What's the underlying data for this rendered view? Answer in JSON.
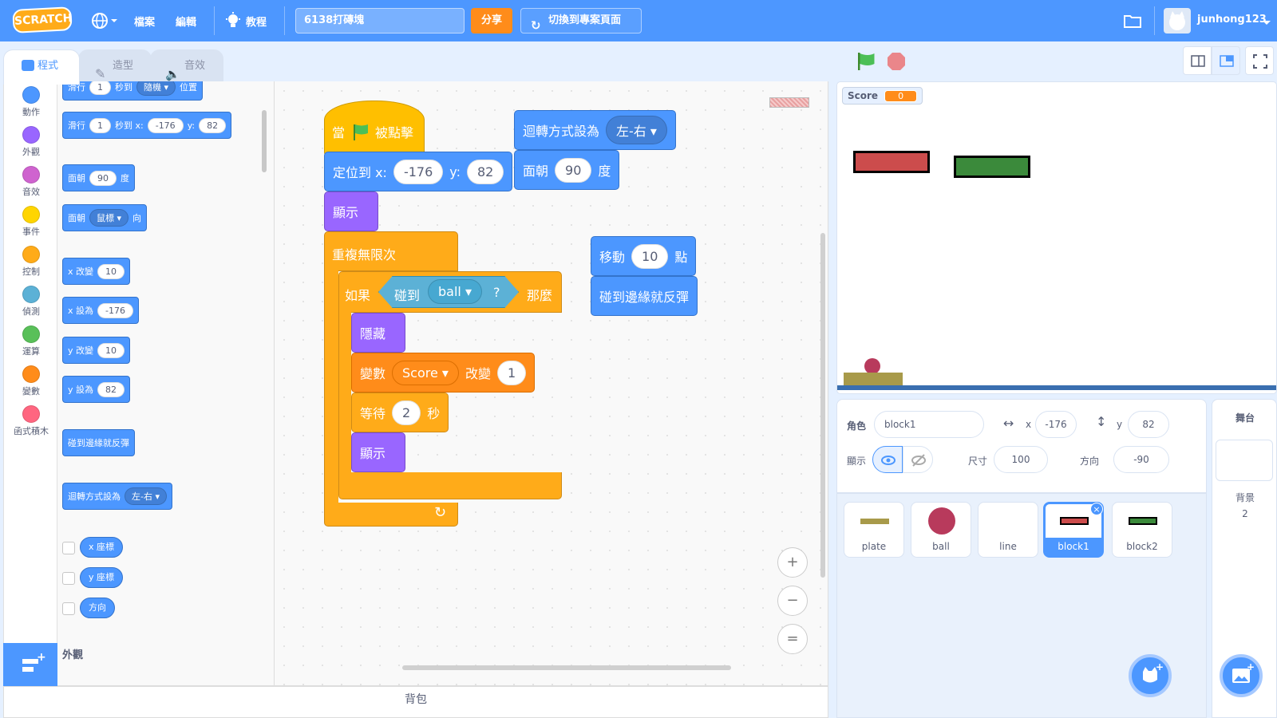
{
  "menubar": {
    "logo": "SCRATCH",
    "file": "檔案",
    "edit": "編輯",
    "tutorials": "教程",
    "project_title": "6138打磚塊",
    "share": "分享",
    "project_page": "切換到專案頁面",
    "username": "junhong123"
  },
  "tabs": {
    "code": "程式",
    "costumes": "造型",
    "sounds": "音效"
  },
  "categories": [
    {
      "label": "動作",
      "color": "#4c97ff"
    },
    {
      "label": "外觀",
      "color": "#9966ff"
    },
    {
      "label": "音效",
      "color": "#cf63cf"
    },
    {
      "label": "事件",
      "color": "#ffd500"
    },
    {
      "label": "控制",
      "color": "#ffab19"
    },
    {
      "label": "偵測",
      "color": "#5cb1d6"
    },
    {
      "label": "運算",
      "color": "#59c059"
    },
    {
      "label": "變數",
      "color": "#ff8c1a"
    },
    {
      "label": "函式積木",
      "color": "#ff6680"
    }
  ],
  "palette": {
    "glide_random": {
      "a": "滑行",
      "secs": "1",
      "b": "秒到",
      "target": "隨機",
      "c": "位置"
    },
    "glide_xy": {
      "a": "滑行",
      "secs": "1",
      "b": "秒到 x:",
      "x": "-176",
      "c": "y:",
      "y": "82"
    },
    "point_dir": {
      "a": "面朝",
      "deg": "90",
      "b": "度"
    },
    "point_towards": {
      "a": "面朝",
      "target": "鼠標",
      "b": "向"
    },
    "change_x": {
      "a": "x 改變",
      "v": "10"
    },
    "set_x": {
      "a": "x 設為",
      "v": "-176"
    },
    "change_y": {
      "a": "y 改變",
      "v": "10"
    },
    "set_y": {
      "a": "y 設為",
      "v": "82"
    },
    "bounce": "碰到邊緣就反彈",
    "rotation_style": {
      "a": "迴轉方式設為",
      "v": "左-右"
    },
    "x_pos": "x 座標",
    "y_pos": "y 座標",
    "direction": "方向",
    "looks_heading": "外觀"
  },
  "script": {
    "when_flag_a": "當",
    "when_flag_b": "被點擊",
    "goto": {
      "a": "定位到 x:",
      "x": "-176",
      "b": "y:",
      "y": "82"
    },
    "show1": "顯示",
    "forever": "重複無限次",
    "if": {
      "a": "如果",
      "touching": "碰到",
      "target": "ball",
      "q": "?",
      "then": "那麼"
    },
    "hide": "隱藏",
    "change_var": {
      "a": "變數",
      "var": "Score",
      "b": "改變",
      "v": "1"
    },
    "wait": {
      "a": "等待",
      "v": "2",
      "b": "秒"
    },
    "show2": "顯示",
    "rotation": {
      "a": "迴轉方式設為",
      "v": "左-右"
    },
    "point": {
      "a": "面朝",
      "v": "90",
      "b": "度"
    },
    "move": {
      "a": "移動",
      "v": "10",
      "b": "點"
    },
    "bounce": "碰到邊緣就反彈"
  },
  "zoom": {
    "in": "+",
    "out": "−",
    "reset": "="
  },
  "backpack": "背包",
  "stage": {
    "score_label": "Score",
    "score_value": "0"
  },
  "sprite_info": {
    "sprite_label": "角色",
    "sprite_name": "block1",
    "x_label": "x",
    "x_value": "-176",
    "y_label": "y",
    "y_value": "82",
    "show_label": "顯示",
    "size_label": "尺寸",
    "size_value": "100",
    "direction_label": "方向",
    "direction_value": "-90"
  },
  "sprites": [
    {
      "name": "plate"
    },
    {
      "name": "ball"
    },
    {
      "name": "line"
    },
    {
      "name": "block1",
      "selected": true
    },
    {
      "name": "block2"
    }
  ],
  "stage_panel": {
    "title": "舞台",
    "backdrops_label": "背景",
    "backdrops_count": "2"
  }
}
